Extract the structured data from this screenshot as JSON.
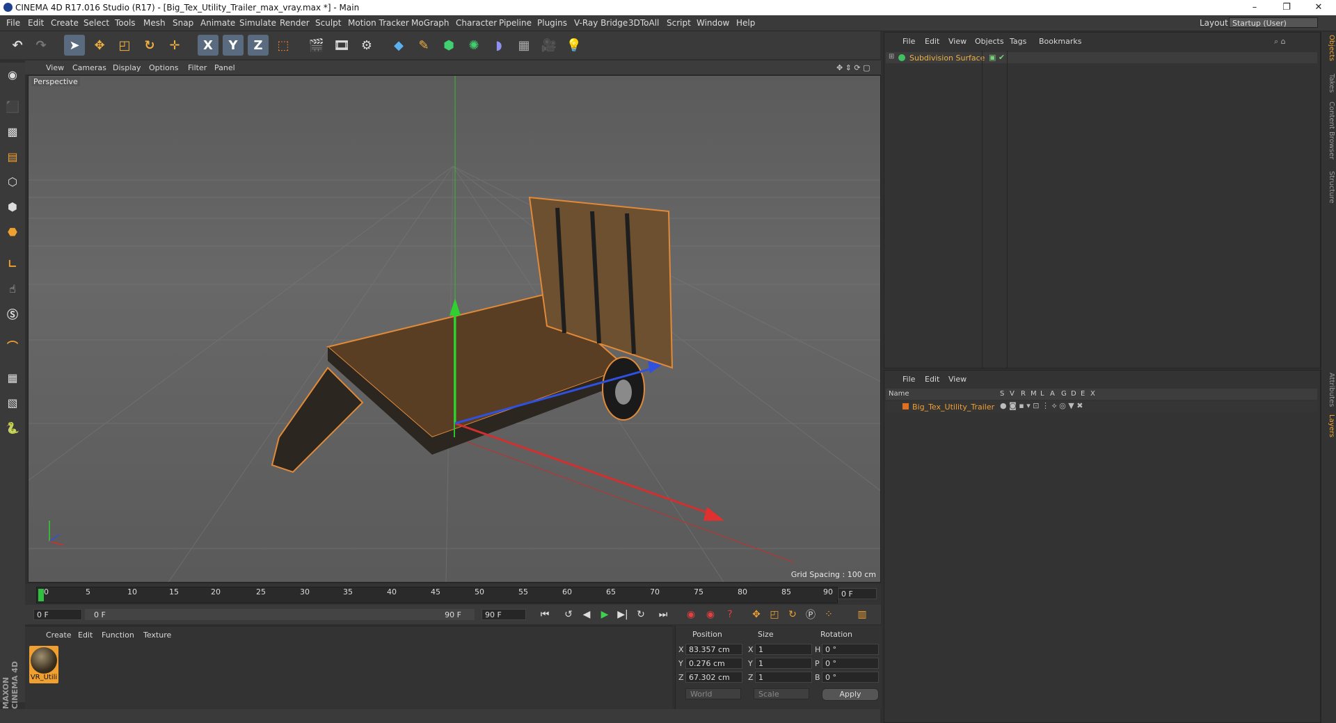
{
  "window": {
    "title": "CINEMA 4D R17.016 Studio (R17) - [Big_Tex_Utility_Trailer_max_vray.max *] - Main",
    "controls": [
      "–",
      "❐",
      "✕"
    ]
  },
  "menubar": {
    "items": [
      "File",
      "Edit",
      "Create",
      "Select",
      "Tools",
      "Mesh",
      "Snap",
      "Animate",
      "Simulate",
      "Render",
      "Sculpt",
      "Motion Tracker",
      "MoGraph",
      "Character",
      "Pipeline",
      "Plugins",
      "V-Ray Bridge",
      "3DToAll",
      "Script",
      "Window",
      "Help"
    ],
    "layout_label": "Layout:",
    "layout_value": "Startup (User)"
  },
  "toolbar": {
    "icons": [
      "undo-icon",
      "redo-icon",
      "select-icon",
      "move-icon",
      "scale-icon",
      "rotate-icon",
      "transform-icon",
      "x-axis-icon",
      "y-axis-icon",
      "z-axis-icon",
      "coord-system-icon",
      "render-view-icon",
      "render-picture-viewer-icon",
      "render-settings-icon",
      "cube-icon",
      "pen-icon",
      "subdivision-icon",
      "array-icon",
      "deformer-icon",
      "floor-icon",
      "camera-icon",
      "light-icon"
    ],
    "axis_labels": [
      "X",
      "Y",
      "Z"
    ]
  },
  "viewport": {
    "menu": [
      "View",
      "Cameras",
      "Display",
      "Options",
      "Filter",
      "Panel"
    ],
    "label": "Perspective",
    "grid_spacing": "Grid Spacing : 100 cm"
  },
  "timeline": {
    "ticks": [
      "0",
      "5",
      "10",
      "15",
      "20",
      "25",
      "30",
      "35",
      "40",
      "45",
      "50",
      "55",
      "60",
      "65",
      "70",
      "75",
      "80",
      "85",
      "90"
    ],
    "current_frame": "0 F"
  },
  "playback": {
    "start": "0 F",
    "range_start": "0 F",
    "range_end": "90 F",
    "end": "90 F"
  },
  "material_manager": {
    "menu": [
      "Create",
      "Edit",
      "Function",
      "Texture"
    ],
    "material_name": "VR_Utili"
  },
  "coordinates": {
    "headers": [
      "Position",
      "Size",
      "Rotation"
    ],
    "rows": [
      {
        "axis": "X",
        "position": "83.357 cm",
        "size_axis": "X",
        "size": "1",
        "rot_axis": "H",
        "rotation": "0 °"
      },
      {
        "axis": "Y",
        "position": "0.276 cm",
        "size_axis": "Y",
        "size": "1",
        "rot_axis": "P",
        "rotation": "0 °"
      },
      {
        "axis": "Z",
        "position": "67.302 cm",
        "size_axis": "Z",
        "size": "1",
        "rot_axis": "B",
        "rotation": "0 °"
      }
    ],
    "mode": "World",
    "transform": "Scale",
    "apply": "Apply"
  },
  "object_manager": {
    "menu": [
      "File",
      "Edit",
      "View",
      "Objects",
      "Tags",
      "Bookmarks"
    ],
    "objects": [
      {
        "name": "Subdivision Surface"
      }
    ]
  },
  "layer_manager": {
    "menu": [
      "File",
      "Edit",
      "View"
    ],
    "columns": [
      "Name",
      "S",
      "V",
      "R",
      "M",
      "L",
      "A",
      "G",
      "D",
      "E",
      "X"
    ],
    "layers": [
      {
        "name": "Big_Tex_Utility_Trailer",
        "color": "#e07020"
      }
    ]
  },
  "right_tabs": [
    "Objects",
    "Takes",
    "Content Browser",
    "Structure",
    "Attributes",
    "Layers"
  ],
  "brand": "MAXON CINEMA 4D",
  "colors": {
    "accent": "#f0a030",
    "selection": "#5a6b80"
  }
}
